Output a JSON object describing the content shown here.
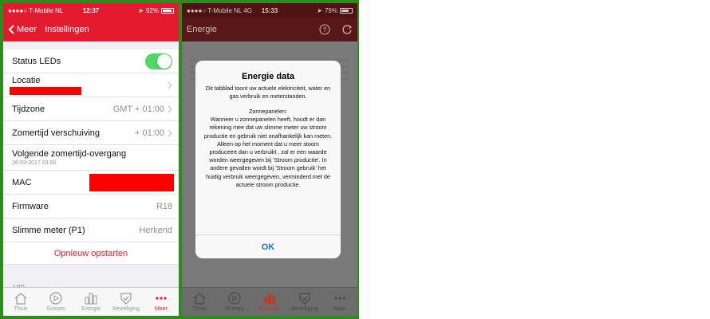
{
  "screen1": {
    "status": {
      "carrier": "●●●●○ T-Mobile NL",
      "time": "12:37",
      "battery": "92%",
      "battery_level": 0.92
    },
    "nav": {
      "back_label": "Meer",
      "title": "Instellingen"
    },
    "rows": {
      "status_leds": "Status LEDs",
      "locatie": "Locatie",
      "tijdzone": "Tijdzone",
      "tijdzone_value": "GMT + 01:00",
      "zomertijd": "Zomertijd verschuiving",
      "zomertijd_value": "+ 01:00",
      "volgende": "Volgende zomertijd-overgang",
      "volgende_sub": "26-03-2017 03:00",
      "mac": "MAC",
      "firmware": "Firmware",
      "firmware_value": "R18",
      "slimme_meter": "Slimme meter (P1)",
      "slimme_meter_value": "Herkend"
    },
    "restart_label": "Opnieuw opstarten",
    "section_app": "APP",
    "tabs": [
      "Thuis",
      "Scenes",
      "Energie",
      "Beveiliging",
      "Meer"
    ]
  },
  "screen2": {
    "status": {
      "carrier": "●●●●○ T-Mobile NL  4G",
      "time": "15:33",
      "battery": "79%",
      "battery_level": 0.79
    },
    "nav": {
      "title": "Energie"
    },
    "modal": {
      "title": "Energie data",
      "text1": "Dit tabblad toont uw actuele elektriciteit, water en gas verbruik en meterstanden.",
      "text2": "Zonnepanelen:\nWanneer u zonnepanelen heeft, houdt er dan rekening mee dat uw slimme meter uw stroom productie en gebruik niet onafhankelijk kan meten. Alleen op het moment dat u meer stoom produceert dan u verbruikt , zal er een waarde worden weergegeven bij 'Stroom productie'. In andere gevallen wordt bij 'Stroom gebruik' het huidig verbruik weergegeven, verminderd met de actuele stroom productie.",
      "ok": "OK"
    },
    "tabs": [
      "Thuis",
      "Scenes",
      "Energie",
      "Beveiliging",
      "Meer"
    ]
  },
  "colors": {
    "brand_red": "#e41b2e",
    "toggle_green": "#4cd964",
    "frame_green": "#2e8b1e",
    "link_blue": "#1a73e8"
  }
}
